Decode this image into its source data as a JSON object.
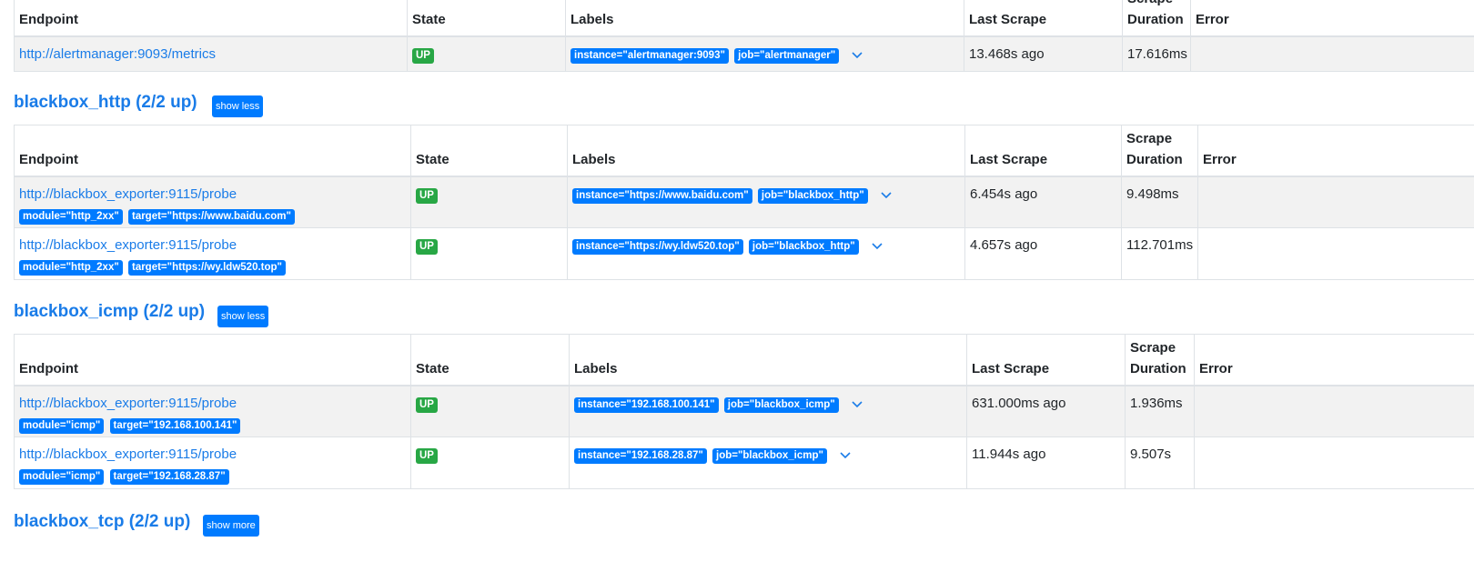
{
  "headers": {
    "endpoint": "Endpoint",
    "state": "State",
    "labels": "Labels",
    "last_scrape": "Last Scrape",
    "scrape_duration": "Scrape Duration",
    "error": "Error"
  },
  "alertmanager": {
    "rows": [
      {
        "endpoint": "http://alertmanager:9093/metrics",
        "state": "UP",
        "labels": [
          "instance=\"alertmanager:9093\"",
          "job=\"alertmanager\""
        ],
        "last_scrape": "13.468s ago",
        "duration": "17.616ms"
      }
    ]
  },
  "blackbox_http": {
    "title": "blackbox_http (2/2 up)",
    "toggle": "show less",
    "rows": [
      {
        "endpoint": "http://blackbox_exporter:9115/probe",
        "params": [
          "module=\"http_2xx\"",
          "target=\"https://www.baidu.com\""
        ],
        "state": "UP",
        "labels": [
          "instance=\"https://www.baidu.com\"",
          "job=\"blackbox_http\""
        ],
        "last_scrape": "6.454s ago",
        "duration": "9.498ms"
      },
      {
        "endpoint": "http://blackbox_exporter:9115/probe",
        "params": [
          "module=\"http_2xx\"",
          "target=\"https://wy.ldw520.top\""
        ],
        "state": "UP",
        "labels": [
          "instance=\"https://wy.ldw520.top\"",
          "job=\"blackbox_http\""
        ],
        "last_scrape": "4.657s ago",
        "duration": "112.701ms"
      }
    ]
  },
  "blackbox_icmp": {
    "title": "blackbox_icmp (2/2 up)",
    "toggle": "show less",
    "rows": [
      {
        "endpoint": "http://blackbox_exporter:9115/probe",
        "params": [
          "module=\"icmp\"",
          "target=\"192.168.100.141\""
        ],
        "state": "UP",
        "labels": [
          "instance=\"192.168.100.141\"",
          "job=\"blackbox_icmp\""
        ],
        "last_scrape": "631.000ms ago",
        "duration": "1.936ms"
      },
      {
        "endpoint": "http://blackbox_exporter:9115/probe",
        "params": [
          "module=\"icmp\"",
          "target=\"192.168.28.87\""
        ],
        "state": "UP",
        "labels": [
          "instance=\"192.168.28.87\"",
          "job=\"blackbox_icmp\""
        ],
        "last_scrape": "11.944s ago",
        "duration": "9.507s"
      }
    ]
  },
  "blackbox_tcp": {
    "title": "blackbox_tcp (2/2 up)",
    "toggle": "show more"
  },
  "icons": {
    "expand": "chevron-down-icon"
  },
  "colors": {
    "link": "#1a7ce8",
    "badge": "#007bff",
    "up": "#28a745",
    "stripe": "#f2f2f2"
  }
}
